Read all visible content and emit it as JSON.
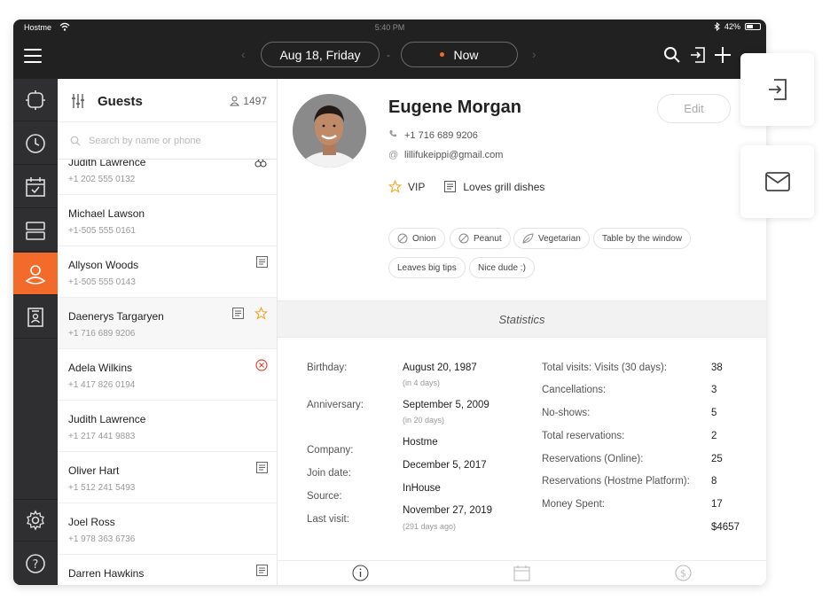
{
  "statusbar": {
    "carrier": "Hostme",
    "time": "5:40 PM",
    "battery": "42%"
  },
  "topbar": {
    "date_label": "Aug 18, Friday",
    "dash": "-",
    "now_label": "Now",
    "accent": "#f26b2b"
  },
  "guests_panel": {
    "title": "Guests",
    "count": "1497",
    "search_placeholder": "Search by name or phone",
    "guests": [
      {
        "name": "Judith Lawrence",
        "phone": "+1 202 555 0132",
        "icon": "allergy-icon"
      },
      {
        "name": "Michael Lawson",
        "phone": "+1-505 555 0161",
        "icon": ""
      },
      {
        "name": "Allyson Woods",
        "phone": "+1-505 555 0143",
        "icon": "note-icon"
      },
      {
        "name": "Daenerys Targaryen",
        "phone": "+1 716 689 9206",
        "icon": "note-icon,star-icon"
      },
      {
        "name": "Adela Wilkins",
        "phone": "+1 417 826 0194",
        "icon": "blocked-icon"
      },
      {
        "name": "Judith Lawrence",
        "phone": "+1 217 441 9883",
        "icon": ""
      },
      {
        "name": "Oliver Hart",
        "phone": "+1 512 241 5493",
        "icon": "note-icon"
      },
      {
        "name": "Joel Ross",
        "phone": "+1 978 363 6736",
        "icon": ""
      },
      {
        "name": "Darren Hawkins",
        "phone": "",
        "icon": "note-icon"
      }
    ]
  },
  "profile": {
    "name": "Eugene Morgan",
    "edit_label": "Edit",
    "phone": "+1 716 689 9206",
    "email": "lillifukeippi@gmail.com",
    "vip_label": "VIP",
    "note": "Loves grill dishes",
    "tags": [
      "Onion",
      "Peanut",
      "Vegetarian",
      "Table by the window",
      "Leaves big tips",
      "Nice dude :)"
    ]
  },
  "statistics": {
    "title": "Statistics",
    "left": {
      "birthday_label": "Birthday:",
      "birthday_value": "August 20, 1987",
      "birthday_sub": "(in 4 days)",
      "anniversary_label": "Anniversary:",
      "anniversary_value": "September 5, 2009",
      "anniversary_sub": "(in 20 days)",
      "company_label": "Company:",
      "company_value": "Hostme",
      "join_label": "Join date:",
      "join_value": "December 5, 2017",
      "source_label": "Source:",
      "source_value": "InHouse",
      "last_label": "Last visit:",
      "last_value": "November 27, 2019",
      "last_sub": "(291 days ago)"
    },
    "right": [
      {
        "label": "Total visits: Visits (30 days):",
        "value": "38"
      },
      {
        "label": "Cancellations:",
        "value": "3"
      },
      {
        "label": "No-shows:",
        "value": "5"
      },
      {
        "label": "Total reservations:",
        "value": "2"
      },
      {
        "label": "Reservations (Online):",
        "value": "25"
      },
      {
        "label": "Reservations (Hostme Platform):",
        "value": "8"
      },
      {
        "label": "Money Spent:",
        "value": "17"
      },
      {
        "label": "",
        "value": "$4657"
      }
    ]
  }
}
